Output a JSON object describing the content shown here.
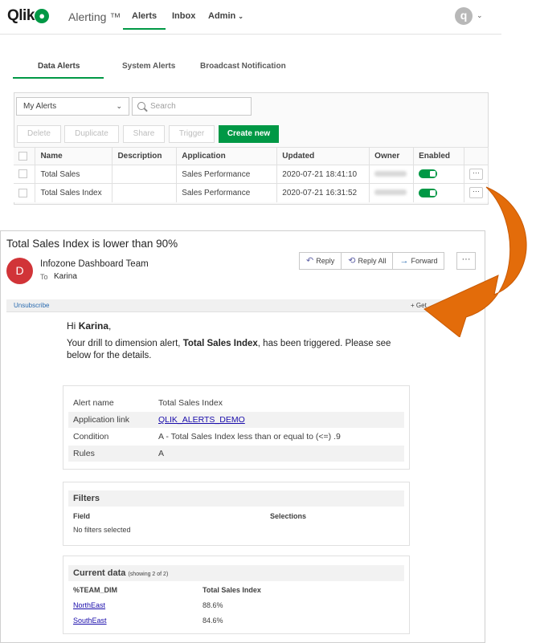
{
  "nav": {
    "logo": "Qlik",
    "app_title": "Alerting ™",
    "items": [
      "Alerts",
      "Inbox",
      "Admin"
    ],
    "user_initial": "q"
  },
  "subtabs": [
    "Data Alerts",
    "System Alerts",
    "Broadcast Notification"
  ],
  "toolbar": {
    "filter_value": "My Alerts",
    "search_placeholder": "Search",
    "buttons": [
      "Delete",
      "Duplicate",
      "Share",
      "Trigger"
    ],
    "create_label": "Create new"
  },
  "table": {
    "headers": [
      "Name",
      "Description",
      "Application",
      "Updated",
      "Owner",
      "Enabled"
    ],
    "rows": [
      {
        "name": "Total Sales",
        "description": "",
        "application": "Sales Performance",
        "updated": "2020-07-21 18:41:10",
        "enabled": true
      },
      {
        "name": "Total Sales Index",
        "description": "",
        "application": "Sales Performance",
        "updated": "2020-07-21 16:31:52",
        "enabled": true
      }
    ],
    "more_label": "···"
  },
  "email": {
    "subject": "Total Sales Index is lower than 90%",
    "sender_initial": "D",
    "sender": "Infozone Dashboard Team",
    "to_label": "To",
    "to": "Karina",
    "actions": [
      "Reply",
      "Reply All",
      "Forward"
    ],
    "more_label": "···",
    "unsubscribe": "Unsubscribe",
    "get_label": "+ Get",
    "greeting_prefix": "Hi",
    "greeting_name": "Karina",
    "body_prefix": "Your drill to dimension alert,",
    "body_alert": "Total Sales Index",
    "body_suffix": ", has been triggered. Please see below for the details.",
    "details": [
      {
        "key": "Alert name",
        "value": "Total Sales Index",
        "link": false
      },
      {
        "key": "Application link",
        "value": "QLIK_ALERTS_DEMO",
        "link": true
      },
      {
        "key": "Condition",
        "value": "A - Total Sales Index less than or equal to (<=) .9",
        "link": false
      },
      {
        "key": "Rules",
        "value": "A",
        "link": false
      }
    ],
    "filters": {
      "title": "Filters",
      "col_field": "Field",
      "col_selections": "Selections",
      "empty": "No filters selected"
    },
    "current": {
      "title": "Current data",
      "showing": "(showing 2 of 2)",
      "col_dim": "%TEAM_DIM",
      "col_val": "Total Sales Index",
      "rows": [
        {
          "dim": "NorthEast",
          "val": "88.6%"
        },
        {
          "dim": "SouthEast",
          "val": "84.6%"
        }
      ]
    }
  },
  "colors": {
    "brand": "#009845",
    "arrow": "#e36c0a",
    "avatar": "#d13438"
  }
}
